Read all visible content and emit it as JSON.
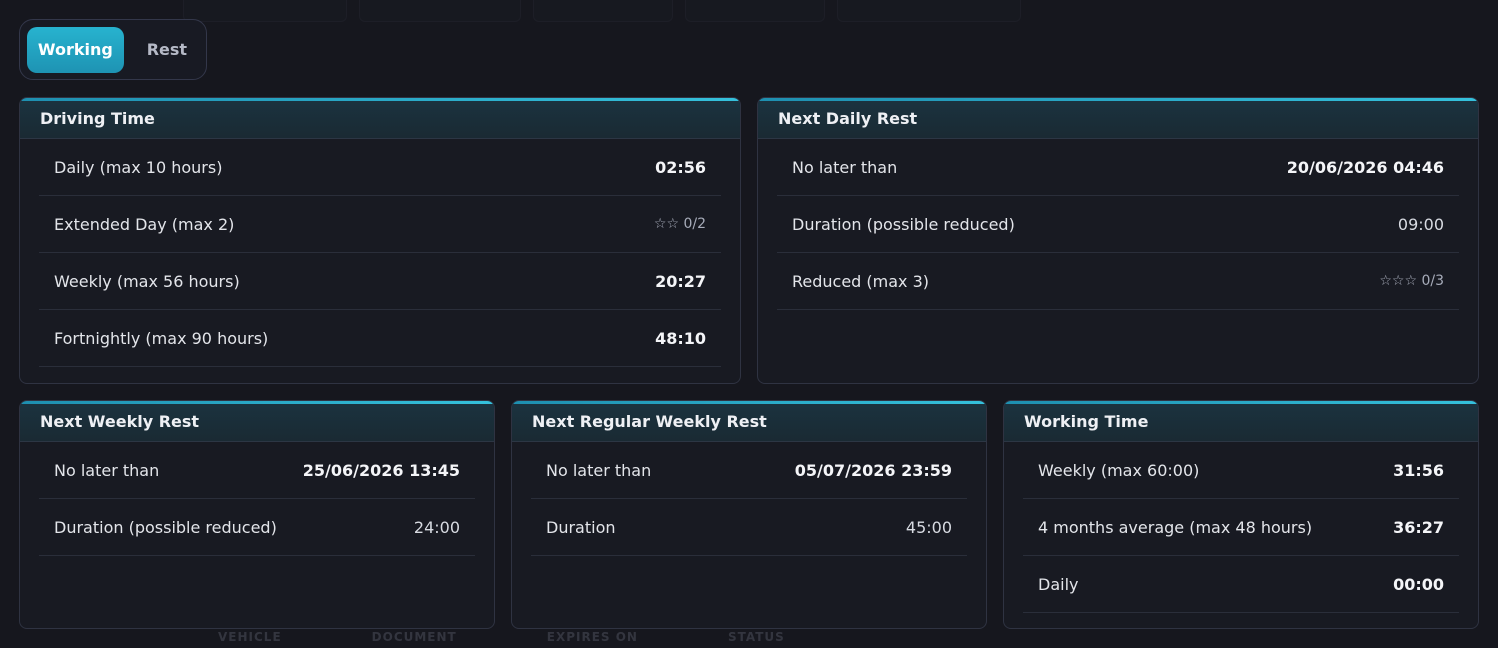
{
  "toggle": {
    "working": "Working",
    "rest": "Rest",
    "active": "Working"
  },
  "background": {
    "columns": [
      "VEHICLE",
      "DOCUMENT",
      "EXPIRES ON",
      "STATUS"
    ]
  },
  "driving_time": {
    "title": "Driving Time",
    "rows": [
      {
        "label": "Daily (max 10 hours)",
        "value": "02:56"
      },
      {
        "label": "Extended Day (max 2)",
        "value": "☆☆ 0/2"
      },
      {
        "label": "Weekly (max 56 hours)",
        "value": "20:27"
      },
      {
        "label": "Fortnightly (max 90 hours)",
        "value": "48:10"
      }
    ]
  },
  "next_daily_rest": {
    "title": "Next Daily Rest",
    "rows": [
      {
        "label": "No later than",
        "value": "20/06/2026 04:46"
      },
      {
        "label": "Duration (possible reduced)",
        "value": "09:00"
      },
      {
        "label": "Reduced (max 3)",
        "value": "☆☆☆ 0/3"
      }
    ]
  },
  "next_weekly_rest": {
    "title": "Next Weekly Rest",
    "rows": [
      {
        "label": "No later than",
        "value": "25/06/2026 13:45"
      },
      {
        "label": "Duration (possible reduced)",
        "value": "24:00"
      }
    ]
  },
  "next_regular_weekly_rest": {
    "title": "Next Regular Weekly Rest",
    "rows": [
      {
        "label": "No later than",
        "value": "05/07/2026 23:59"
      },
      {
        "label": "Duration",
        "value": "45:00"
      }
    ]
  },
  "working_time": {
    "title": "Working Time",
    "rows": [
      {
        "label": "Weekly (max 60:00)",
        "value": "31:56"
      },
      {
        "label": "4 months average (max 48 hours)",
        "value": "36:27"
      },
      {
        "label": "Daily",
        "value": "00:00"
      }
    ]
  },
  "colors": {
    "accent": "#27b3cf",
    "background": "#16171e",
    "card": "#181a22"
  }
}
